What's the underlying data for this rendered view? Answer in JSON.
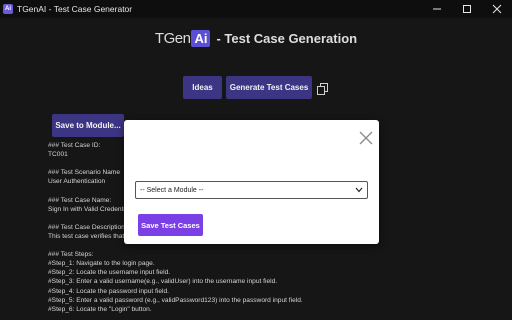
{
  "window": {
    "title": "TGenAI - Test Case Generator",
    "icon_letter": "Ai"
  },
  "header": {
    "logo_text": "TGen",
    "logo_badge": "Ai",
    "title": "- Test Case Generation"
  },
  "toolbar": {
    "ideas_label": "Ideas",
    "generate_label": "Generate Test Cases"
  },
  "save_module_label": "Save to Module...",
  "result_lines": [
    "### Test Case ID:",
    "TC001",
    "",
    "### Test Scenario Name",
    "User Authentication",
    "",
    "### Test Case Name:",
    "Sign In with Valid Credenti",
    "",
    "### Test Case Description",
    "This test case verifies that",
    "",
    "### Test Steps:",
    "#Step_1: Navigate to the login page.",
    "#Step_2: Locate the username input field.",
    "#Step_3: Enter a valid username(e.g., validUser) into the username input field.",
    "#Step_4: Locate the password input field.",
    "#Step_5: Enter a valid password (e.g., validPassword123) into the password input field.",
    "#Step_6: Locate the \"Login\" button."
  ],
  "modal": {
    "select_placeholder": "-- Select a Module --",
    "save_label": "Save Test Cases"
  },
  "colors": {
    "accent_dark": "#3c3583",
    "accent_purple": "#7b3fe6",
    "background": "#161616"
  },
  "icons": [
    "app-icon",
    "minimize-icon",
    "maximize-icon",
    "close-icon",
    "copy-icon",
    "modal-close-icon",
    "chevron-down-icon"
  ]
}
